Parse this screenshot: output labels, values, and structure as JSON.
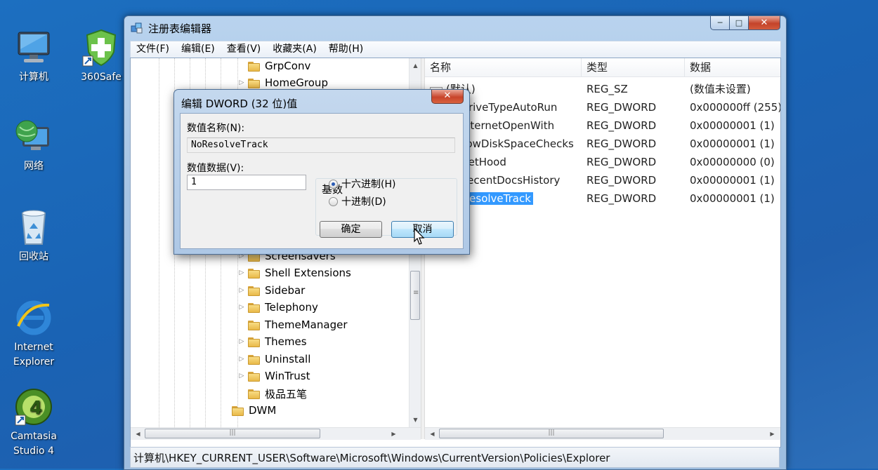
{
  "desktop": {
    "icons": [
      {
        "label": "计算机",
        "icon": "computer-icon"
      },
      {
        "label": "360Safe",
        "icon": "shield-plus-icon"
      },
      {
        "label": "网络",
        "icon": "network-globe-icon"
      },
      {
        "label": "回收站",
        "icon": "recycle-bin-icon"
      },
      {
        "label": "Internet\nExplorer",
        "icon": "internet-explorer-icon"
      },
      {
        "label": "Camtasia\nStudio 4",
        "icon": "camtasia-icon"
      }
    ]
  },
  "window": {
    "title": "注册表编辑器",
    "menu": [
      "文件(F)",
      "编辑(E)",
      "查看(V)",
      "收藏夹(A)",
      "帮助(H)"
    ],
    "caption_buttons": {
      "minimize": "─",
      "maximize": "□",
      "close": "✕"
    }
  },
  "tree": {
    "items": [
      {
        "label": "GrpConv",
        "expander": ""
      },
      {
        "label": "HomeGroup",
        "expander": "▷"
      },
      {
        "label": "Screensavers",
        "expander": "▷"
      },
      {
        "label": "Shell Extensions",
        "expander": "▷"
      },
      {
        "label": "Sidebar",
        "expander": "▷"
      },
      {
        "label": "Telephony",
        "expander": "▷"
      },
      {
        "label": "ThemeManager",
        "expander": ""
      },
      {
        "label": "Themes",
        "expander": "▷"
      },
      {
        "label": "Uninstall",
        "expander": "▷"
      },
      {
        "label": "WinTrust",
        "expander": "▷"
      },
      {
        "label": "极品五笔",
        "expander": ""
      },
      {
        "label": "DWM",
        "expander": ""
      }
    ]
  },
  "list": {
    "columns": [
      "名称",
      "类型",
      "数据"
    ],
    "rows": [
      {
        "name": "(默认)",
        "type": "REG_SZ",
        "data": "(数值未设置)"
      },
      {
        "name": "NoDriveTypeAutoRun",
        "type": "REG_DWORD",
        "data": "0x000000ff (255)"
      },
      {
        "name": "NoInternetOpenWith",
        "type": "REG_DWORD",
        "data": "0x00000001 (1)"
      },
      {
        "name": "NoLowDiskSpaceChecks",
        "type": "REG_DWORD",
        "data": "0x00000001 (1)"
      },
      {
        "name": "NoNetHood",
        "type": "REG_DWORD",
        "data": "0x00000000 (0)"
      },
      {
        "name": "NoRecentDocsHistory",
        "type": "REG_DWORD",
        "data": "0x00000001 (1)"
      },
      {
        "name": "NoResolveTrack",
        "type": "REG_DWORD",
        "data": "0x00000001 (1)"
      }
    ]
  },
  "status": {
    "path": "计算机\\HKEY_CURRENT_USER\\Software\\Microsoft\\Windows\\CurrentVersion\\Policies\\Explorer"
  },
  "dialog": {
    "title": "编辑 DWORD (32 位)值",
    "close": "✕",
    "name_label": "数值名称(N):",
    "name_value": "NoResolveTrack",
    "data_label": "数值数据(V):",
    "data_value": "1",
    "base_label": "基数",
    "radio_hex": "十六进制(H)",
    "radio_dec": "十进制(D)",
    "selected_base": "hex",
    "ok": "确定",
    "cancel": "取消"
  }
}
